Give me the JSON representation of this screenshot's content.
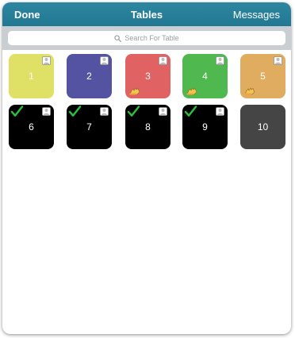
{
  "navbar": {
    "left_label": "Done",
    "title": "Tables",
    "right_label": "Messages",
    "color": "#2a82a0"
  },
  "search": {
    "placeholder": "Search For Table"
  },
  "tables": [
    {
      "number": "1",
      "color": "#dfe166",
      "occupied": true,
      "checked": false,
      "service_request": false
    },
    {
      "number": "2",
      "color": "#5353a1",
      "occupied": true,
      "checked": false,
      "service_request": false
    },
    {
      "number": "3",
      "color": "#e06262",
      "occupied": true,
      "checked": false,
      "service_request": true
    },
    {
      "number": "4",
      "color": "#4fb950",
      "occupied": true,
      "checked": false,
      "service_request": true
    },
    {
      "number": "5",
      "color": "#e0ac60",
      "occupied": true,
      "checked": false,
      "service_request": true
    },
    {
      "number": "6",
      "color": "#000000",
      "occupied": true,
      "checked": true,
      "service_request": false
    },
    {
      "number": "7",
      "color": "#000000",
      "occupied": true,
      "checked": true,
      "service_request": false
    },
    {
      "number": "8",
      "color": "#000000",
      "occupied": true,
      "checked": true,
      "service_request": false
    },
    {
      "number": "9",
      "color": "#000000",
      "occupied": true,
      "checked": true,
      "service_request": false
    },
    {
      "number": "10",
      "color": "#454545",
      "occupied": false,
      "checked": false,
      "service_request": false
    }
  ],
  "icons": {
    "occupied": "person-icon",
    "checked": "checkmark-icon",
    "service_request": "waving-hand-icon",
    "search": "search-icon"
  },
  "colors": {
    "check": "#25c23a",
    "search_bar_bg": "#c9ced3"
  }
}
